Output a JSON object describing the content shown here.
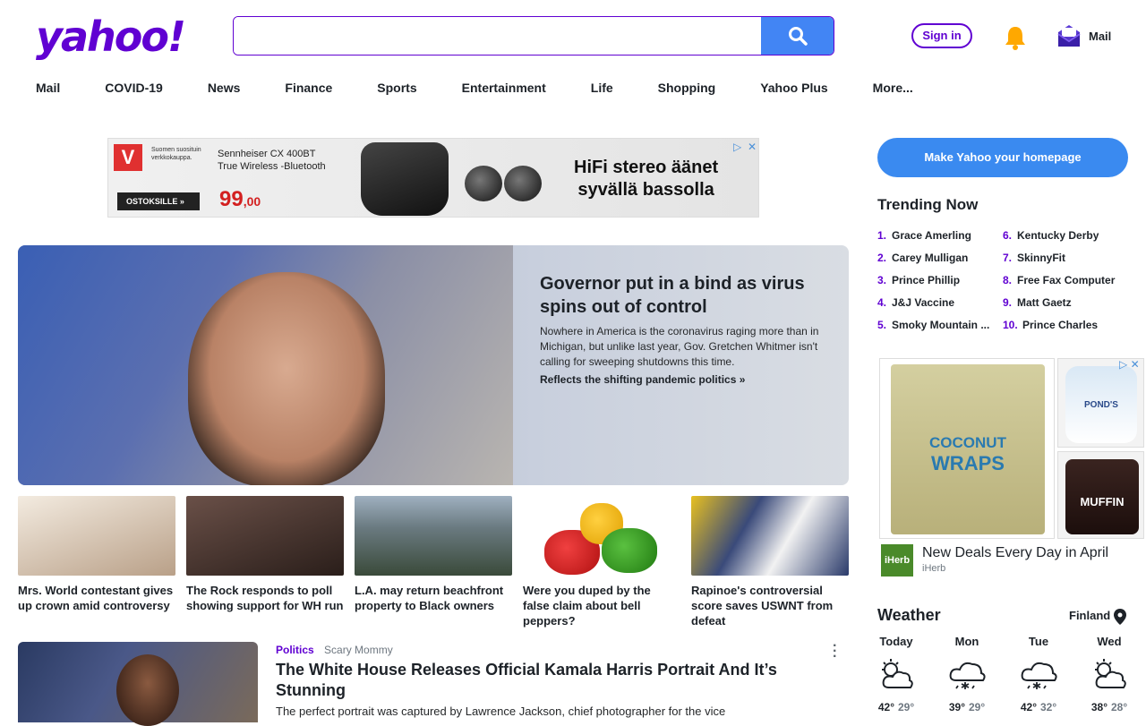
{
  "header": {
    "logo": "yahoo!",
    "search": {
      "value": "",
      "placeholder": ""
    },
    "signin_label": "Sign in",
    "mail_label": "Mail"
  },
  "nav": [
    "Mail",
    "COVID-19",
    "News",
    "Finance",
    "Sports",
    "Entertainment",
    "Life",
    "Shopping",
    "Yahoo Plus",
    "More..."
  ],
  "ad_banner": {
    "brand_letter": "V",
    "brand_tagline": "Suomen suosituin verkkokauppa.",
    "product": [
      "Sennheiser CX 400BT",
      "True Wireless -Bluetooth"
    ],
    "cta": "OSTOKSILLE »",
    "price_main": "99",
    "price_cents": ",00",
    "headline": [
      "HiFi stereo äänet",
      "syvällä bassolla"
    ]
  },
  "hero": {
    "title": "Governor put in a bind as virus spins out of control",
    "description": "Nowhere in America is the coronavirus raging more than in Michigan, but unlike last year, Gov. Gretchen Whitmer isn't calling for sweeping shutdowns this time.",
    "link": "Reflects the shifting pandemic politics »"
  },
  "thumbs": [
    {
      "caption": "Mrs. World contestant gives up crown amid controversy",
      "color": "#e9ddd0"
    },
    {
      "caption": "The Rock responds to poll showing support for WH run",
      "color": "#4a3a34"
    },
    {
      "caption": "L.A. may return beachfront property to Black owners",
      "color": "#5a6a7a"
    },
    {
      "caption": "Were you duped by the false claim about bell peppers?",
      "color": "#ffffff"
    },
    {
      "caption": "Rapinoe's controversial score saves USWNT from defeat",
      "color": "#2a3a5a"
    }
  ],
  "story": {
    "category": "Politics",
    "source": "Scary Mommy",
    "title": "The White House Releases Official Kamala Harris Portrait And It’s Stunning",
    "description": "The perfect portrait was captured by Lawrence Jackson, chief photographer for the vice"
  },
  "sidebar": {
    "homepage_button": "Make Yahoo your homepage",
    "trending_title": "Trending Now",
    "trending": [
      {
        "num": "1.",
        "label": "Grace Amerling"
      },
      {
        "num": "2.",
        "label": "Carey Mulligan"
      },
      {
        "num": "3.",
        "label": "Prince Phillip"
      },
      {
        "num": "4.",
        "label": "J&J Vaccine"
      },
      {
        "num": "5.",
        "label": "Smoky Mountain ..."
      },
      {
        "num": "6.",
        "label": "Kentucky Derby"
      },
      {
        "num": "7.",
        "label": "SkinnyFit"
      },
      {
        "num": "8.",
        "label": "Free Fax Computer"
      },
      {
        "num": "9.",
        "label": "Matt Gaetz"
      },
      {
        "num": "10.",
        "label": "Prince Charles"
      }
    ],
    "side_ad": {
      "wrap_line1": "COCONUT",
      "wrap_line2": "WRAPS",
      "ponds": "POND'S",
      "muffin": "MUFFIN",
      "logo": "iHerb",
      "title": "New Deals Every Day in April",
      "sponsor": "iHerb"
    },
    "weather": {
      "title": "Weather",
      "location": "Finland",
      "days": [
        {
          "name": "Today",
          "hi": "42°",
          "lo": "29°",
          "icon": "partly-cloudy-icon"
        },
        {
          "name": "Mon",
          "hi": "39°",
          "lo": "29°",
          "icon": "snow-cloud-icon"
        },
        {
          "name": "Tue",
          "hi": "42°",
          "lo": "32°",
          "icon": "snow-cloud-icon"
        },
        {
          "name": "Wed",
          "hi": "38°",
          "lo": "28°",
          "icon": "partly-cloudy-icon"
        }
      ]
    }
  }
}
